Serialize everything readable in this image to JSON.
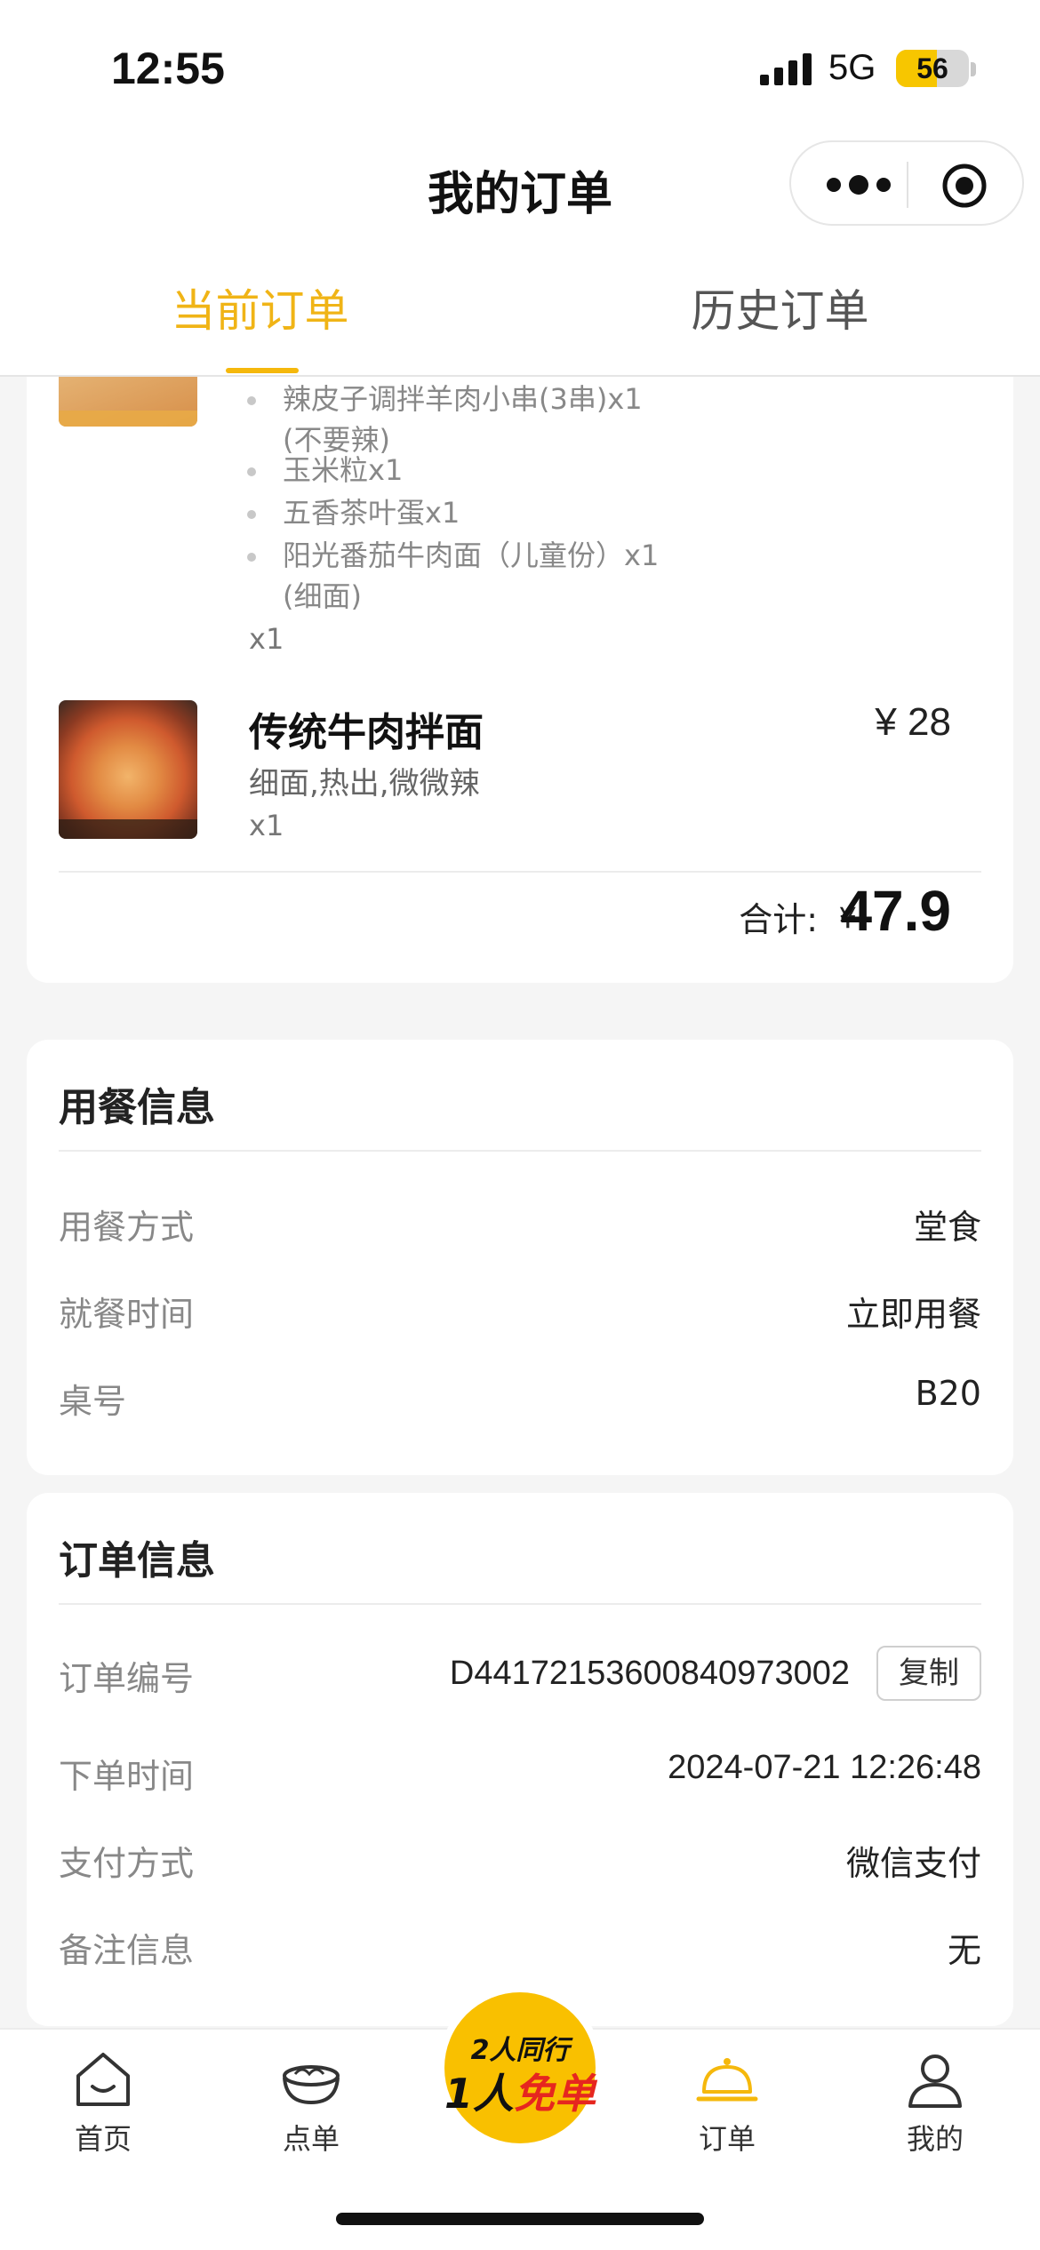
{
  "status_bar": {
    "time": "12:55",
    "network": "5G",
    "battery": "56",
    "battery_level": 0.56
  },
  "header": {
    "title": "我的订单"
  },
  "tabs": [
    {
      "label": "当前订单",
      "active": true
    },
    {
      "label": "历史订单",
      "active": false
    }
  ],
  "order": {
    "combo_subitems": [
      {
        "text": "辣皮子调拌羊肉小串(3串)x1"
      },
      {
        "text": "(不要辣)"
      },
      {
        "text": "玉米粒x1"
      },
      {
        "text": "五香茶叶蛋x1"
      },
      {
        "text": "阳光番茄牛肉面（儿童份）x1"
      },
      {
        "text": "(细面)"
      }
    ],
    "combo_qty": "x1",
    "item": {
      "name": "传统牛肉拌面",
      "spec": "细面,热出,微微辣",
      "qty": "x1",
      "price": "¥ 28"
    },
    "total_label": "合计:",
    "total_yen": "¥",
    "total_amount": "47.9"
  },
  "dining_info": {
    "title": "用餐信息",
    "rows": [
      {
        "label": "用餐方式",
        "value": "堂食"
      },
      {
        "label": "就餐时间",
        "value": "立即用餐"
      },
      {
        "label": "桌号",
        "value": "B20"
      }
    ]
  },
  "order_info": {
    "title": "订单信息",
    "order_no_label": "订单编号",
    "order_no": "D44172153600840973002",
    "copy_label": "复制",
    "rows": [
      {
        "label": "下单时间",
        "value": "2024-07-21 12:26:48"
      },
      {
        "label": "支付方式",
        "value": "微信支付"
      },
      {
        "label": "备注信息",
        "value": "无"
      }
    ]
  },
  "nav": {
    "items": [
      {
        "label": "首页",
        "icon": "home-icon"
      },
      {
        "label": "点单",
        "icon": "bowl-icon"
      },
      {
        "label": "订单",
        "icon": "cloche-icon",
        "active": true
      },
      {
        "label": "我的",
        "icon": "user-icon"
      }
    ],
    "promo_line1": "2人同行",
    "promo_line2_a": "1人",
    "promo_line2_b": "免单"
  },
  "colors": {
    "accent": "#f5b80c",
    "brand_yellow": "#f9c000",
    "text_gray": "#888888"
  }
}
